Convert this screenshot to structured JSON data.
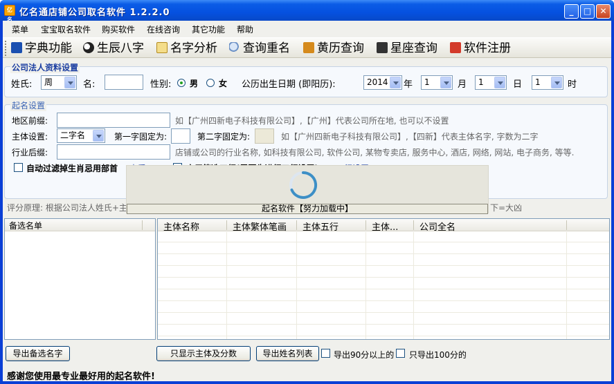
{
  "window": {
    "icon_text": "亿名",
    "title": "亿名通店铺公司取名软件 1.2.2.0",
    "min": "_",
    "max": "□",
    "close": "✕"
  },
  "menu": [
    "菜单",
    "宝宝取名软件",
    "购买软件",
    "在线咨询",
    "其它功能",
    "帮助"
  ],
  "toolbar": [
    {
      "label": "字典功能",
      "icon": "book-icon",
      "color": "#1a4fb0"
    },
    {
      "label": "生辰八字",
      "icon": "yin-yang-icon",
      "color": "#222222"
    },
    {
      "label": "名字分析",
      "icon": "note-edit-icon",
      "color": "#e5b23a"
    },
    {
      "label": "查询重名",
      "icon": "magnifier-icon",
      "color": "#6f93c7"
    },
    {
      "label": "黄历查询",
      "icon": "calendar-icon",
      "color": "#d58a1c"
    },
    {
      "label": "星座查询",
      "icon": "star-sign-icon",
      "color": "#333333"
    },
    {
      "label": "软件注册",
      "icon": "register-icon",
      "color": "#d33a2a"
    }
  ],
  "legal": {
    "title": "公司法人资料设置",
    "surname_label": "姓氏:",
    "surname_value": "周",
    "given_label": "名:",
    "given_value": "",
    "gender_label": "性别:",
    "male": "男",
    "female": "女",
    "gender_selected": "男",
    "birth_label": "公历出生日期 (即阳历):",
    "year_value": "2014",
    "year_unit": "年",
    "month_value": "1",
    "month_unit": "月",
    "day_value": "1",
    "day_unit": "日",
    "hour_value": "1",
    "hour_unit": "时"
  },
  "naming": {
    "title": "起名设置",
    "region_label": "地区前缀:",
    "region_value": "",
    "region_hint": "如【广州四新电子科技有限公司】,【广州】代表公司所在地, 也可以不设置",
    "subject_label": "主体设置:",
    "subject_value": "二字名",
    "first_fixed_label": "第一字固定为:",
    "first_fixed_value": "",
    "second_fixed_label": "第二字固定为:",
    "second_fixed_value": "",
    "subject_hint": "如【广州四新电子科技有限公司】,【四新】代表主体名字, 字数为二字",
    "industry_label": "行业后缀:",
    "industry_value": "",
    "industry_hint": "店铺或公司的行业名称, 如科技有限公司, 软件公司, 某物专卖店, 服务中心, 酒店, 网络, 网站, 电子商务, 等等.",
    "filter_label": "自动过滤掉生肖忌用部首",
    "filter_link": "查看",
    "custom_label": "启用筛选工行(需要先进行工行设置)",
    "custom_link": "工行设置"
  },
  "score_principle": "评分原理: 根据公司法人姓氏+主体",
  "score_tail": "下=大凶",
  "loading": {
    "text": "起名软件【努力加载中】"
  },
  "candidates": {
    "header": "备选名单"
  },
  "results": {
    "columns": [
      "主体名称",
      "主体繁体笔画",
      "主体五行",
      "主体...",
      "公司全名"
    ]
  },
  "bottom": {
    "export_candidates": "导出备选名字",
    "only_subject": "只显示主体及分数",
    "export_list": "导出姓名列表",
    "export_90": "导出90分以上的",
    "export_100": "只导出100分的"
  },
  "status": "感谢您使用最专业最好用的起名软件!"
}
